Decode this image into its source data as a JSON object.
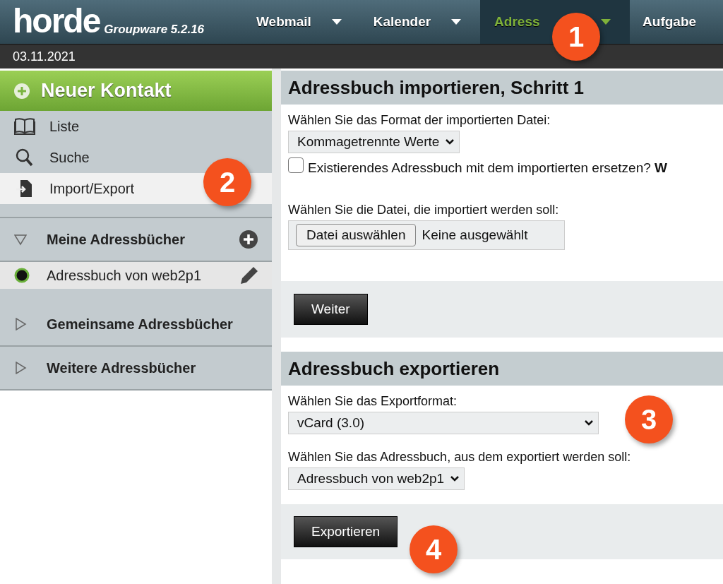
{
  "logo": {
    "name": "horde",
    "product": "Groupware 5.2.16"
  },
  "nav": [
    {
      "label": "Webmail",
      "selected": false,
      "caret": true
    },
    {
      "label": "Kalender",
      "selected": false,
      "caret": true
    },
    {
      "label": "Adress",
      "selected": true,
      "caret": true
    },
    {
      "label": "Aufgabe",
      "selected": false,
      "caret": false
    }
  ],
  "date": "03.11.2021",
  "sidebar": {
    "new_contact": "Neuer Kontakt",
    "items": [
      {
        "label": "Liste",
        "selected": false
      },
      {
        "label": "Suche",
        "selected": false
      },
      {
        "label": "Import/Export",
        "selected": true
      }
    ],
    "sections": [
      {
        "title": "Meine Adressbücher",
        "expanded": true,
        "add": true,
        "books": [
          {
            "name": "Adressbuch von web2p1",
            "selected": true
          }
        ]
      },
      {
        "title": "Gemeinsame Adressbücher",
        "expanded": false,
        "add": false
      },
      {
        "title": "Weitere Adressbücher",
        "expanded": false,
        "add": false
      }
    ]
  },
  "import": {
    "title": "Adressbuch importieren, Schritt 1",
    "format_label": "Wählen Sie das Format der importierten Datei:",
    "format_value": "Kommagetrennte Werte",
    "replace": {
      "label": "Existierendes Adressbuch mit dem importierten ersetzen? **W**",
      "checked": false
    },
    "file_label": "Wählen Sie die Datei, die importiert werden soll:",
    "file_button": "Datei auswählen",
    "file_status": "Keine ausgewählt",
    "button": "Weiter"
  },
  "export": {
    "title": "Adressbuch exportieren",
    "format_label": "Wählen Sie das Exportformat:",
    "format_value": "vCard (3.0)",
    "book_label": "Wählen Sie das Adressbuch, aus dem exportiert werden soll:",
    "book_value": "Adressbuch von web2p1",
    "button": "Exportieren"
  },
  "callouts": [
    {
      "number": "1"
    },
    {
      "number": "2"
    },
    {
      "number": "3"
    },
    {
      "number": "4"
    }
  ]
}
